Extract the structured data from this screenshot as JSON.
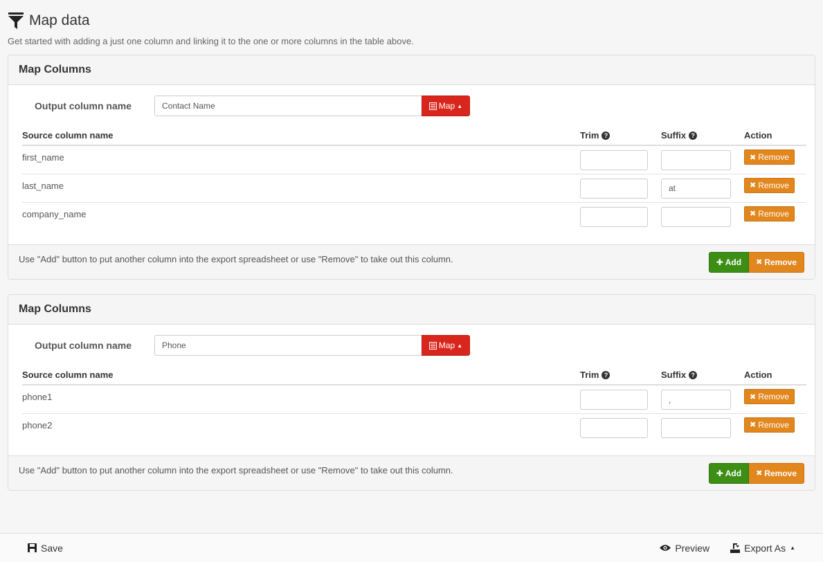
{
  "page": {
    "title": "Map data",
    "intro": "Get started with adding a just one column and linking it to the one or more columns in the table above."
  },
  "panels": [
    {
      "heading": "Map Columns",
      "output_label": "Output column name",
      "output_value": "Contact Name",
      "map_label": "Map",
      "headers": {
        "source": "Source column name",
        "trim": "Trim",
        "suffix": "Suffix",
        "action": "Action"
      },
      "rows": [
        {
          "source": "first_name",
          "trim": "",
          "suffix": "",
          "remove": "Remove"
        },
        {
          "source": "last_name",
          "trim": "",
          "suffix": "at",
          "remove": "Remove"
        },
        {
          "source": "company_name",
          "trim": "",
          "suffix": "",
          "remove": "Remove"
        }
      ],
      "footer_text": "Use \"Add\" button to put another column into the export spreadsheet or use \"Remove\" to take out this column.",
      "add_label": "Add",
      "remove_label": "Remove"
    },
    {
      "heading": "Map Columns",
      "output_label": "Output column name",
      "output_value": "Phone",
      "map_label": "Map",
      "headers": {
        "source": "Source column name",
        "trim": "Trim",
        "suffix": "Suffix",
        "action": "Action"
      },
      "rows": [
        {
          "source": "phone1",
          "trim": "",
          "suffix": ",",
          "remove": "Remove"
        },
        {
          "source": "phone2",
          "trim": "",
          "suffix": "",
          "remove": "Remove"
        }
      ],
      "footer_text": "Use \"Add\" button to put another column into the export spreadsheet or use \"Remove\" to take out this column.",
      "add_label": "Add",
      "remove_label": "Remove"
    }
  ],
  "bottom_bar": {
    "save_label": "Save",
    "preview_label": "Preview",
    "export_label": "Export As"
  },
  "colors": {
    "map_button": "#d9261c",
    "add_button": "#3c8e14",
    "remove_button": "#e2861e"
  }
}
